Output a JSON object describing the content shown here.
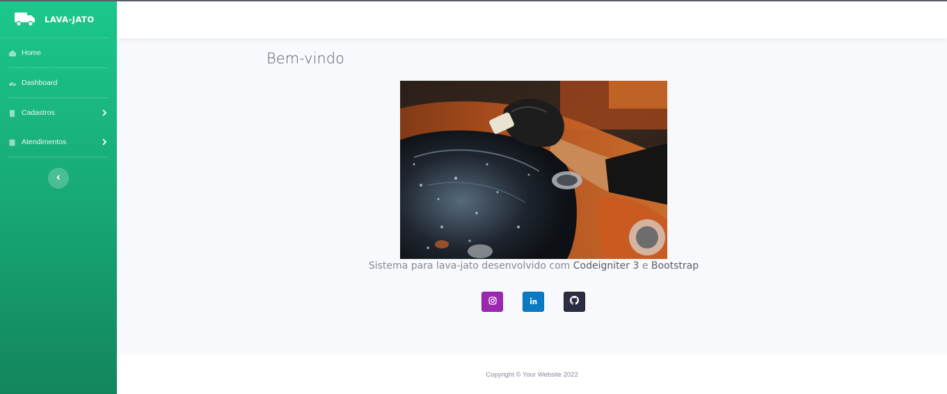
{
  "brand": {
    "name": "LAVA-JATO",
    "icon": "truck-icon"
  },
  "sidebar": {
    "items": [
      {
        "label": "Home",
        "icon": "home-icon",
        "has_submenu": false
      },
      {
        "label": "Dashboard",
        "icon": "tachometer-icon",
        "has_submenu": false
      },
      {
        "label": "Cadastros",
        "icon": "clipboard-icon",
        "has_submenu": true
      },
      {
        "label": "Atendimentos",
        "icon": "calendar-icon",
        "has_submenu": true
      }
    ],
    "toggle_icon": "chevron-left-icon"
  },
  "main": {
    "title": "Bem-vindo",
    "image_alt": "car washing photo",
    "caption": {
      "prefix": "Sistema para lava-jato desenvolvido com",
      "framework1": "Codeigniter 3",
      "joiner": "e",
      "framework2": "Bootstrap"
    },
    "social": [
      {
        "name": "instagram",
        "icon": "instagram-icon",
        "color": "#9c27b0"
      },
      {
        "name": "linkedin",
        "icon": "linkedin-icon",
        "color": "#0a7ac4"
      },
      {
        "name": "github",
        "icon": "github-icon",
        "color": "#2b2d42"
      }
    ]
  },
  "footer": {
    "copyright": "Copyright © Your Website 2022"
  },
  "colors": {
    "sidebar_top": "#1cc88a",
    "sidebar_bottom": "#13855c",
    "page_bg": "#f8f9fc",
    "text_muted": "#858796",
    "text_dark": "#5a5c69"
  }
}
